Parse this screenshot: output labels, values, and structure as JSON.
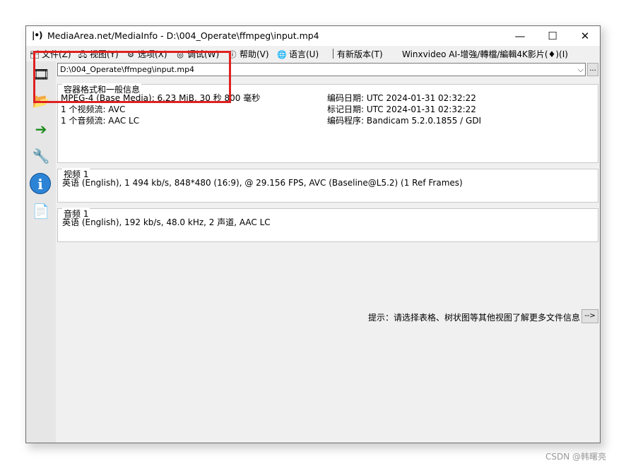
{
  "window": {
    "title": "MediaArea.net/MediaInfo - D:\\004_Operate\\ffmpeg\\input.mp4",
    "app_icon": "|•)",
    "min_glyph": "—",
    "max_glyph": "☐",
    "close_glyph": "✕"
  },
  "menu": {
    "items": [
      {
        "label": "文件(Z)",
        "icon": "file-icon",
        "glyph": "🗂"
      },
      {
        "label": "视图(Y)",
        "icon": "view-icon",
        "glyph": "🖧"
      },
      {
        "label": "选项(X)",
        "icon": "options-icon",
        "glyph": "⚙"
      },
      {
        "label": "调试(W)",
        "icon": "debug-icon",
        "glyph": "◎"
      },
      {
        "label": "帮助(V)",
        "icon": "help-icon",
        "glyph": "ⓘ"
      },
      {
        "label": "语言(U)",
        "icon": "language-icon",
        "glyph": "🌐"
      }
    ],
    "new_version": "有新版本(T)",
    "promo": "Winxvideo AI-增強/轉檔/編輯4K影片(♦)(I)"
  },
  "sidebar": {
    "info_glyph": "i"
  },
  "file_selector": {
    "path": "D:\\004_Operate\\ffmpeg\\input.mp4",
    "chevron": "⌵",
    "browse_label": "..."
  },
  "general": {
    "title": "容器格式和一般信息",
    "lines": [
      "MPEG-4 (Base Media): 6.23 MiB, 30 秒 800 毫秒",
      "1 个视频流: AVC",
      "1 个音频流: AAC LC"
    ],
    "right_lines": [
      "编码日期: UTC 2024-01-31 02:32:22",
      "标记日期: UTC 2024-01-31 02:32:22",
      "编码程序: Bandicam 5.2.0.1855 / GDI"
    ]
  },
  "video": {
    "title": "视频 1",
    "line": "英语 (English), 1 494 kb/s, 848*480 (16:9), @ 29.156 FPS, AVC (Baseline@L5.2) (1 Ref Frames)"
  },
  "audio": {
    "title": "音频 1",
    "line": "英语 (English), 192 kb/s, 48.0 kHz, 2 声道, AAC LC"
  },
  "hint": {
    "text": "提示：请选择表格、树状图等其他视图了解更多文件信息",
    "button": "-->"
  },
  "watermark": "CSDN @韩曙亮",
  "colors": {
    "highlight": "#e02020",
    "info_icon": "#2d84d6"
  }
}
